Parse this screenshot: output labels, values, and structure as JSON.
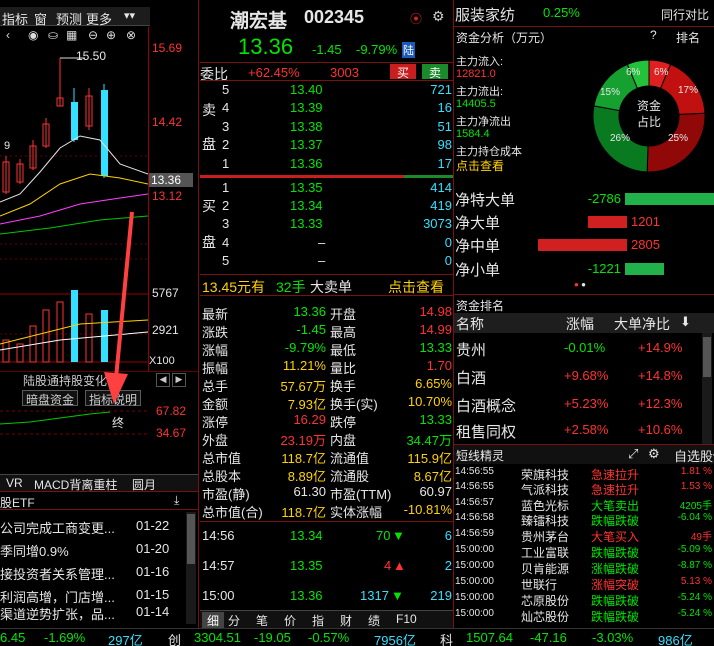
{
  "left_toolbar": {
    "items": [
      "指标",
      "窗",
      "预测",
      "更多"
    ]
  },
  "chart": {
    "price_labels": [
      "15.69",
      "14.42",
      "13.36",
      "13.12"
    ],
    "vol_labels": [
      "5767",
      "2921"
    ],
    "x100": "X100",
    "high_marker": "15.50",
    "ma_marker": "9"
  },
  "indicator_tabs": {
    "tab1": "陆股通持股变化",
    "tab2": "暗盘资金",
    "tab3": "指标说明",
    "v1": "67.82",
    "v2": "34.67",
    "end_label": "终"
  },
  "bottom_tabs": [
    "VR",
    "MACD背离重柱",
    "圆月"
  ],
  "news": {
    "header": "股ETF",
    "items": [
      {
        "t": "公司完成工商变更...",
        "d": "01-22"
      },
      {
        "t": "季同增0.9%",
        "d": "01-20"
      },
      {
        "t": "接投资者关系管理...",
        "d": "01-16"
      },
      {
        "t": "利润高增，门店增...",
        "d": "01-15"
      },
      {
        "t": "渠道逆势扩张，品...",
        "d": "01-14"
      }
    ]
  },
  "stock": {
    "name": "潮宏基",
    "code": "002345",
    "badge": "陆",
    "price": "13.36",
    "change": "-1.45",
    "pct": "-9.79%"
  },
  "weibi": {
    "label": "委比",
    "value": "+62.45%",
    "diff": "3003",
    "buy": "买",
    "sell": "卖"
  },
  "sell_orders": [
    {
      "lv": "5",
      "p": "13.40",
      "v": "721"
    },
    {
      "lv": "4",
      "p": "13.39",
      "v": "16"
    },
    {
      "lv": "3",
      "p": "13.38",
      "v": "51"
    },
    {
      "lv": "2",
      "p": "13.37",
      "v": "98"
    },
    {
      "lv": "1",
      "p": "13.36",
      "v": "17"
    }
  ],
  "buy_orders": [
    {
      "lv": "1",
      "p": "13.35",
      "v": "414"
    },
    {
      "lv": "2",
      "p": "13.34",
      "v": "419"
    },
    {
      "lv": "3",
      "p": "13.33",
      "v": "3073"
    },
    {
      "lv": "4",
      "p": "–",
      "v": "0"
    },
    {
      "lv": "5",
      "p": "–",
      "v": "0"
    }
  ],
  "side_labels": {
    "sell1": "卖",
    "sell2": "盘",
    "buy1": "买",
    "buy2": "盘"
  },
  "big_order": {
    "price": "13.45元有",
    "qty": "32手",
    "label": "大卖单",
    "link": "点击查看"
  },
  "stats": [
    {
      "l1": "最新",
      "v1": "13.36",
      "l2": "开盘",
      "v2": "14.98"
    },
    {
      "l1": "涨跌",
      "v1": "-1.45",
      "l2": "最高",
      "v2": "14.99"
    },
    {
      "l1": "涨幅",
      "v1": "-9.79%",
      "l2": "最低",
      "v2": "13.33"
    },
    {
      "l1": "振幅",
      "v1": "11.21%",
      "l2": "量比",
      "v2": "1.70"
    },
    {
      "l1": "总手",
      "v1": "57.67万",
      "l2": "换手",
      "v2": "6.65%"
    },
    {
      "l1": "金额",
      "v1": "7.93亿",
      "l2": "换手(实)",
      "v2": "10.70%"
    },
    {
      "l1": "涨停",
      "v1": "16.29",
      "l2": "跌停",
      "v2": "13.33"
    },
    {
      "l1": "外盘",
      "v1": "23.19万",
      "l2": "内盘",
      "v2": "34.47万"
    },
    {
      "l1": "总市值",
      "v1": "118.7亿",
      "l2": "流通值",
      "v2": "115.9亿"
    },
    {
      "l1": "总股本",
      "v1": "8.89亿",
      "l2": "流通股",
      "v2": "8.67亿"
    },
    {
      "l1": "市盈(静)",
      "v1": "61.30",
      "l2": "市盈(TTM)",
      "v2": "60.97"
    },
    {
      "l1": "总市值(合)",
      "v1": "118.7亿",
      "l2": "实体涨幅",
      "v2": "-10.81%"
    }
  ],
  "ticks": [
    {
      "t": "14:56",
      "p": "13.34",
      "v": "70",
      "n": "6"
    },
    {
      "t": "14:57",
      "p": "13.35",
      "v": "4",
      "n": "2"
    },
    {
      "t": "15:00",
      "p": "13.36",
      "v": "1317",
      "n": "219"
    }
  ],
  "detail_tabs": [
    "细",
    "分",
    "笔",
    "价",
    "指",
    "财",
    "绩",
    "F10"
  ],
  "sector": {
    "name": "服装家纺",
    "pct": "0.25%",
    "compare": "同行对比"
  },
  "capital": {
    "title": "资金分析（万元）",
    "rank": "排名",
    "in_label": "主力流入:",
    "in_val": "12821.0",
    "out_label": "主力流出:",
    "out_val": "14405.5",
    "net_label": "主力净流出",
    "net_val": "1584.4",
    "hold_label": "主力持仓成本",
    "link": "点击查看",
    "donut_center_1": "资金",
    "donut_center_2": "占比",
    "slices": [
      {
        "v": 6,
        "c": "#e02020"
      },
      {
        "v": 17,
        "c": "#c01010"
      },
      {
        "v": 25,
        "c": "#900808"
      },
      {
        "v": 26,
        "c": "#0a7a20"
      },
      {
        "v": 15,
        "c": "#15a030"
      },
      {
        "v": 6,
        "c": "#23c23a"
      }
    ],
    "slice_labels": [
      "6%",
      "17%",
      "25%",
      "26%",
      "15%",
      "6%"
    ]
  },
  "flows": [
    {
      "label": "净特大单",
      "value": "-2786",
      "frac": 0.98,
      "color": "#22b24c"
    },
    {
      "label": "净大单",
      "value": "1201",
      "frac": 0.42,
      "color": "#d02020"
    },
    {
      "label": "净中单",
      "value": "2805",
      "frac": 0.97,
      "color": "#d02020"
    },
    {
      "label": "净小单",
      "value": "-1221",
      "frac": 0.42,
      "color": "#22b24c"
    }
  ],
  "ranking": {
    "title": "资金排名",
    "h1": "名称",
    "h2": "涨幅",
    "h3": "大单净比",
    "rows": [
      {
        "n": "贵州",
        "p": "-0.01%",
        "r": "+14.9%"
      },
      {
        "n": "白酒",
        "p": "+9.68%",
        "r": "+14.8%"
      },
      {
        "n": "白酒概念",
        "p": "+5.23%",
        "r": "+12.3%"
      },
      {
        "n": "租售同权",
        "p": "+2.58%",
        "r": "+10.6%"
      }
    ]
  },
  "short_move": {
    "title": "短线精灵",
    "select": "自选股",
    "rows": [
      {
        "t": "14:56:55",
        "n": "荣旗科技",
        "e": "急速拉升",
        "v": "1.81 %"
      },
      {
        "t": "14:56:55",
        "n": "气派科技",
        "e": "急速拉升",
        "v": "1.53 %"
      },
      {
        "t": "14:56:57",
        "n": "蓝色光标",
        "e": "大笔卖出",
        "v": "4205手"
      },
      {
        "t": "14:56:58",
        "n": "臻镭科技",
        "e": "跌幅跌破",
        "v": "-6.04 %"
      },
      {
        "t": "14:56:59",
        "n": "贵州茅台",
        "e": "大笔买入",
        "v": "49手"
      },
      {
        "t": "15:00:00",
        "n": "工业富联",
        "e": "跌幅跌破",
        "v": "-5.09 %"
      },
      {
        "t": "15:00:00",
        "n": "贝肯能源",
        "e": "涨幅跌破",
        "v": "-8.87 %"
      },
      {
        "t": "15:00:00",
        "n": "世联行",
        "e": "涨幅突破",
        "v": "5.13 %"
      },
      {
        "t": "15:00:00",
        "n": "芯原股份",
        "e": "跌幅跌破",
        "v": "-5.24 %"
      },
      {
        "t": "15:00:00",
        "n": "灿芯股份",
        "e": "跌幅跌破",
        "v": "-5.24 %"
      }
    ]
  },
  "footer": {
    "a1": "6.45",
    "a2": "-1.69%",
    "a3": "297亿",
    "b0": "创",
    "b1": "3304.51",
    "b2": "-19.05",
    "b3": "-0.57%",
    "b4": "7956亿",
    "c0": "科",
    "c1": "1507.64",
    "c2": "-47.16",
    "c3": "-3.03%",
    "c4": "986亿"
  }
}
